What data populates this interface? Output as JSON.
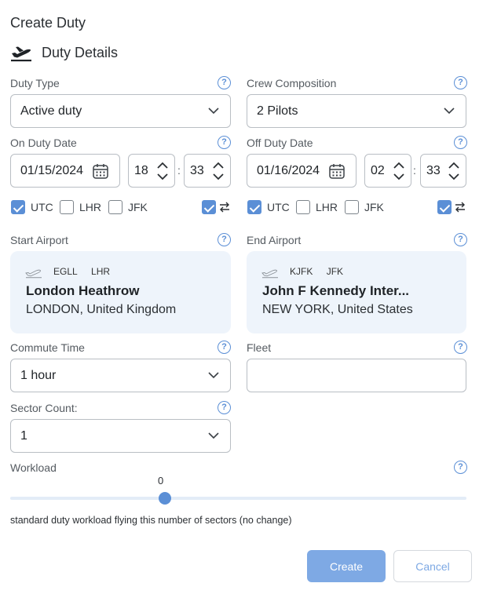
{
  "dialog": {
    "title": "Create Duty",
    "section_title": "Duty Details"
  },
  "duty_type": {
    "label": "Duty Type",
    "value": "Active duty"
  },
  "crew": {
    "label": "Crew Composition",
    "value": "2 Pilots"
  },
  "on_duty": {
    "label": "On Duty Date",
    "date": "01/15/2024",
    "hour": "18",
    "minute": "33",
    "tz": [
      {
        "label": "UTC",
        "checked": true
      },
      {
        "label": "LHR",
        "checked": false
      },
      {
        "label": "JFK",
        "checked": false
      }
    ],
    "swap_checked": true
  },
  "off_duty": {
    "label": "Off Duty Date",
    "date": "01/16/2024",
    "hour": "02",
    "minute": "33",
    "tz": [
      {
        "label": "UTC",
        "checked": true
      },
      {
        "label": "LHR",
        "checked": false
      },
      {
        "label": "JFK",
        "checked": false
      }
    ],
    "swap_checked": true
  },
  "start_airport": {
    "label": "Start Airport",
    "icao": "EGLL",
    "iata": "LHR",
    "name": "London Heathrow",
    "location": "LONDON, United Kingdom"
  },
  "end_airport": {
    "label": "End Airport",
    "icao": "KJFK",
    "iata": "JFK",
    "name": "John F Kennedy Inter...",
    "location": "NEW YORK, United States"
  },
  "commute": {
    "label": "Commute Time",
    "value": "1 hour"
  },
  "fleet": {
    "label": "Fleet",
    "value": ""
  },
  "sector_count": {
    "label": "Sector Count:",
    "value": "1"
  },
  "workload": {
    "label": "Workload",
    "value": "0",
    "description": "standard duty workload flying this number of sectors (no change)"
  },
  "help_glyph": "?",
  "time_separator": ":",
  "buttons": {
    "create": "Create",
    "cancel": "Cancel"
  },
  "colors": {
    "accent": "#5b8fd6",
    "create_bg": "#7ea9e4",
    "airport_bg": "#eef4fb"
  }
}
